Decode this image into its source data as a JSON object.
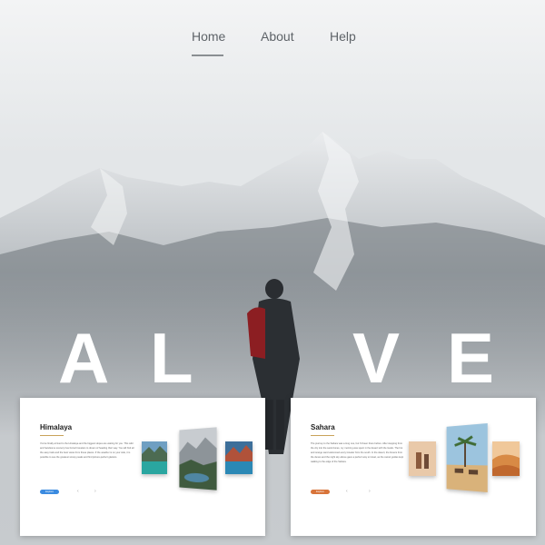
{
  "nav": {
    "items": [
      {
        "label": "Home",
        "active": true
      },
      {
        "label": "About"
      },
      {
        "label": "Help"
      }
    ]
  },
  "hero": {
    "letters": [
      "A",
      "L",
      "V",
      "E"
    ]
  },
  "cards": [
    {
      "title": "Himalaya",
      "text": "You've finally arrived to the Himalaya and the biggest slopes are waiting for you. This wild and handsome scenery has forced travelers to dream of heading their way. You will find all the easy trails and the best views from these places. If the weather is on your side, it is possible to see the greatest snowy peaks and find picture-perfect glaciers.",
      "button": "Explore",
      "accent": "#3b8be0"
    },
    {
      "title": "Sahara",
      "text": "The journey to the Sahara was a long one, but I'd been there before. After stepping from the city into the sand dunes, my morning was spent in the desert with the locals. The hot and orange sand welcomed every traveler from the south. In the desert, the breeze from the dunes and the night sky above gave a perfect way to travel, as the camel guides kept walking to the edge of the Sahara.",
      "button": "Explore",
      "accent": "#d8743a"
    }
  ],
  "colors": {
    "nav_text": "#5e6368",
    "hero_text": "#ffffff",
    "card_bg": "#ffffff"
  }
}
